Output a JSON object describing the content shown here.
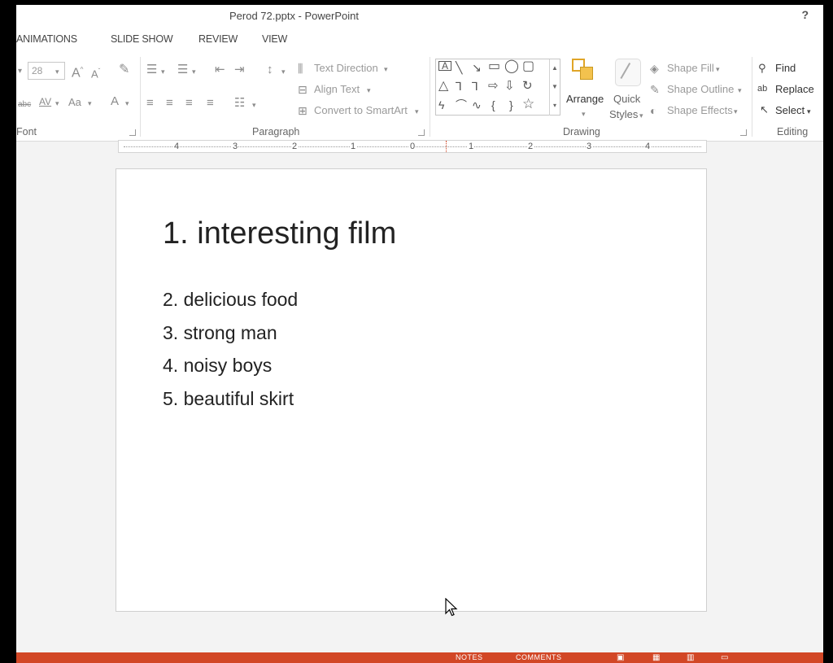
{
  "window": {
    "title": "Perod 72.pptx - PowerPoint",
    "help": "?"
  },
  "tabs": [
    "ANIMATIONS",
    "SLIDE SHOW",
    "REVIEW",
    "VIEW"
  ],
  "ribbon": {
    "font": {
      "size": "28",
      "label": "Font",
      "change_case": "Aa"
    },
    "paragraph": {
      "label": "Paragraph",
      "text_direction": "Text Direction",
      "align_text": "Align Text",
      "convert_smartart": "Convert to SmartArt"
    },
    "drawing": {
      "label": "Drawing",
      "arrange": "Arrange",
      "quick_styles_1": "Quick",
      "quick_styles_2": "Styles",
      "shape_fill": "Shape Fill",
      "shape_outline": "Shape Outline",
      "shape_effects": "Shape Effects"
    },
    "editing": {
      "label": "Editing",
      "find": "Find",
      "replace": "Replace",
      "select": "Select"
    }
  },
  "ruler": {
    "labels": [
      "4",
      "3",
      "2",
      "1",
      "0",
      "1",
      "2",
      "3",
      "4"
    ]
  },
  "slide": {
    "title": "1. interesting film",
    "items": [
      "2. delicious food",
      "3. strong man",
      "4. noisy boys",
      "5. beautiful skirt"
    ]
  },
  "statusbar": {
    "notes": "NOTES",
    "comments": "COMMENTS"
  },
  "colors": {
    "accent": "#d24726"
  }
}
